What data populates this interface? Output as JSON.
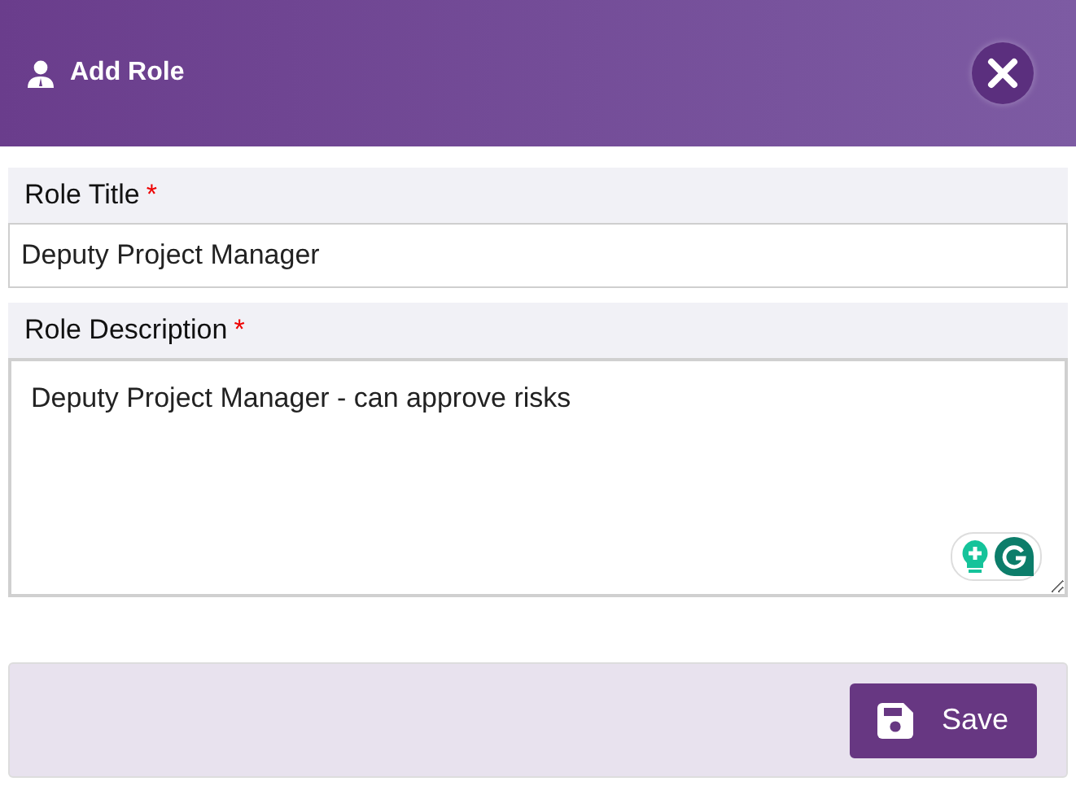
{
  "dialog": {
    "title": "Add Role"
  },
  "fields": [
    {
      "kind": "input",
      "label": "Role Title",
      "required": true,
      "required_mark": "*",
      "value": "Deputy Project Manager"
    },
    {
      "kind": "textarea",
      "label": "Role Description",
      "required": true,
      "required_mark": "*",
      "value": "Deputy Project Manager - can approve risks"
    }
  ],
  "footer": {
    "save_button": "Save"
  }
}
